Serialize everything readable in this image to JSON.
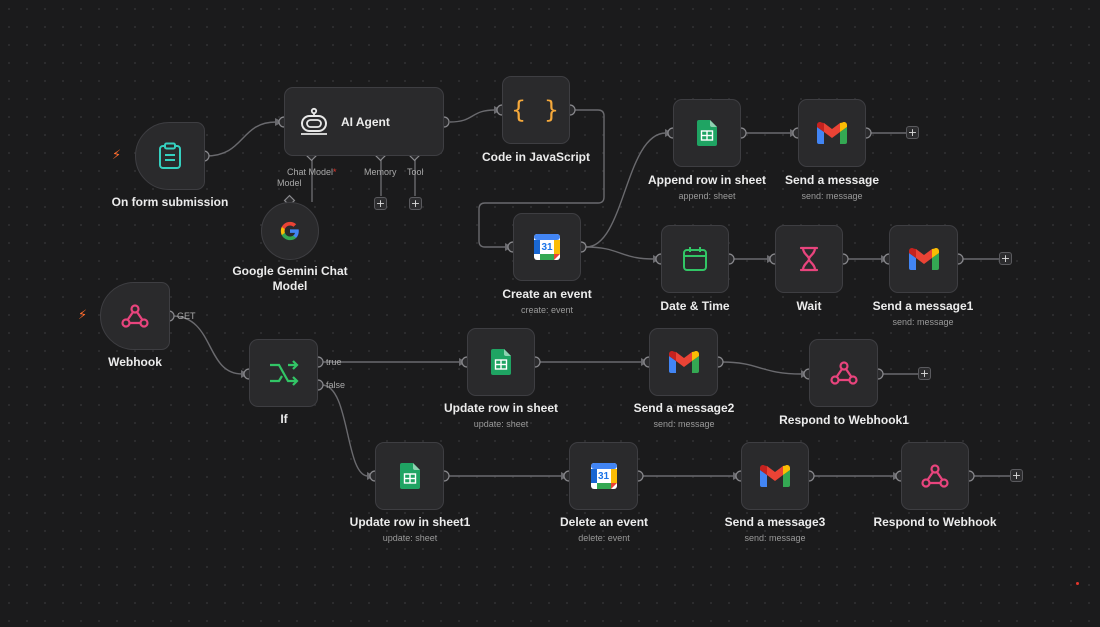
{
  "canvas": {
    "colors": {
      "background": "#1b1b1c",
      "node_bg": "#2a2a2c",
      "wire": "#6a6a6e",
      "trigger_bolt": "#ff6b2c",
      "webhook_pink": "#e8447d",
      "form_teal": "#35d0c0",
      "sheets_green": "#1fa463",
      "calendar_green": "#32c566",
      "js_orange": "#f6a93b"
    }
  },
  "nodes": {
    "form_trigger": {
      "label": "On form submission",
      "icon": "clipboard-icon"
    },
    "ai_agent": {
      "label": "AI Agent",
      "icon": "robot-icon",
      "ports": {
        "chat_model": "Chat Model",
        "required_mark": "*",
        "memory": "Memory",
        "tool": "Tool"
      }
    },
    "gemini": {
      "label": "Google Gemini Chat Model",
      "label_line1": "Google Gemini Chat",
      "label_line2": "Model",
      "port_label": "Model",
      "icon": "google-icon"
    },
    "code_js": {
      "label": "Code in JavaScript",
      "icon": "curly-braces-icon",
      "glyph": "{ }"
    },
    "create_event": {
      "label": "Create an event",
      "sub": "create: event",
      "icon": "google-calendar-icon",
      "day": "31"
    },
    "append_row": {
      "label": "Append row in sheet",
      "sub": "append: sheet",
      "icon": "google-sheets-icon"
    },
    "send_message": {
      "label": "Send a message",
      "sub": "send: message",
      "icon": "gmail-icon"
    },
    "date_time": {
      "label": "Date & Time",
      "icon": "calendar-icon"
    },
    "wait": {
      "label": "Wait",
      "icon": "hourglass-icon"
    },
    "send_message1": {
      "label": "Send a message1",
      "sub": "send: message",
      "icon": "gmail-icon"
    },
    "webhook": {
      "label": "Webhook",
      "icon": "webhook-icon",
      "method": "GET"
    },
    "if_node": {
      "label": "If",
      "icon": "branch-icon",
      "true_label": "true",
      "false_label": "false"
    },
    "update_row": {
      "label": "Update row in sheet",
      "sub": "update: sheet",
      "icon": "google-sheets-icon"
    },
    "send_message2": {
      "label": "Send a message2",
      "sub": "send: message",
      "icon": "gmail-icon"
    },
    "respond_webhook1": {
      "label": "Respond to Webhook1",
      "icon": "webhook-icon"
    },
    "update_row1": {
      "label": "Update row in sheet1",
      "sub": "update: sheet",
      "icon": "google-sheets-icon"
    },
    "delete_event": {
      "label": "Delete an event",
      "sub": "delete: event",
      "icon": "google-calendar-icon",
      "day": "31"
    },
    "send_message3": {
      "label": "Send a message3",
      "sub": "send: message",
      "icon": "gmail-icon"
    },
    "respond_webhook": {
      "label": "Respond to Webhook",
      "icon": "webhook-icon"
    }
  },
  "symbols": {
    "plus": "+",
    "bolt": "⚡"
  }
}
